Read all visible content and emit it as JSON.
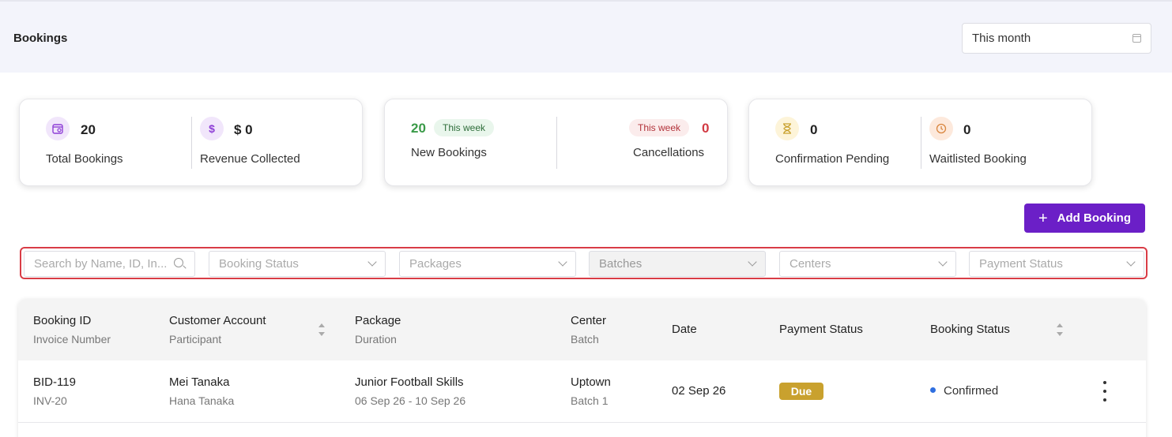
{
  "header": {
    "title": "Bookings",
    "date_filter": "This month"
  },
  "stats": {
    "total_bookings": {
      "value": "20",
      "label": "Total Bookings"
    },
    "revenue_collected": {
      "value": "$ 0",
      "label": "Revenue Collected",
      "icon_glyph": "$"
    },
    "new_bookings": {
      "value": "20",
      "badge": "This week",
      "label": "New Bookings"
    },
    "cancellations": {
      "value": "0",
      "badge": "This week",
      "label": "Cancellations"
    },
    "confirmation_pending": {
      "value": "0",
      "label": "Confirmation Pending"
    },
    "waitlisted_booking": {
      "value": "0",
      "label": "Waitlisted Booking"
    }
  },
  "actions": {
    "add_booking": "Add Booking",
    "add_glyph": "+"
  },
  "filters": {
    "search_placeholder": "Search by Name, ID, In...",
    "booking_status": "Booking Status",
    "packages": "Packages",
    "batches": "Batches",
    "centers": "Centers",
    "payment_status": "Payment Status"
  },
  "table": {
    "columns": [
      {
        "main": "Booking ID",
        "sub": "Invoice Number"
      },
      {
        "main": "Customer Account",
        "sub": "Participant"
      },
      {
        "main": "Package",
        "sub": "Duration"
      },
      {
        "main": "Center",
        "sub": "Batch"
      },
      {
        "main": "Date",
        "sub": ""
      },
      {
        "main": "Payment Status",
        "sub": ""
      },
      {
        "main": "Booking Status",
        "sub": ""
      }
    ],
    "rows": [
      {
        "booking_id": "BID-119",
        "invoice": "INV-20",
        "customer": "Mei Tanaka",
        "participant": "Hana Tanaka",
        "package": "Junior Football Skills",
        "duration": "06 Sep 26 - 10 Sep 26",
        "center": "Uptown",
        "batch": "Batch 1",
        "date": "02 Sep 26",
        "payment_status": "Due",
        "booking_status": "Confirmed"
      }
    ]
  },
  "colors": {
    "accent": "#6b1fc7",
    "new_bookings": "#3a9a48",
    "cancellations": "#d23a43",
    "due_badge": "#c9a12e",
    "confirmed_dot": "#2f6fe0",
    "filter_highlight": "#d93c46"
  },
  "icons": [
    "calendar-icon",
    "dollar-icon",
    "hourglass-icon",
    "clock-icon",
    "plus-icon",
    "search-icon",
    "chevron-down-icon",
    "sort-icon",
    "kebab-menu-icon"
  ]
}
